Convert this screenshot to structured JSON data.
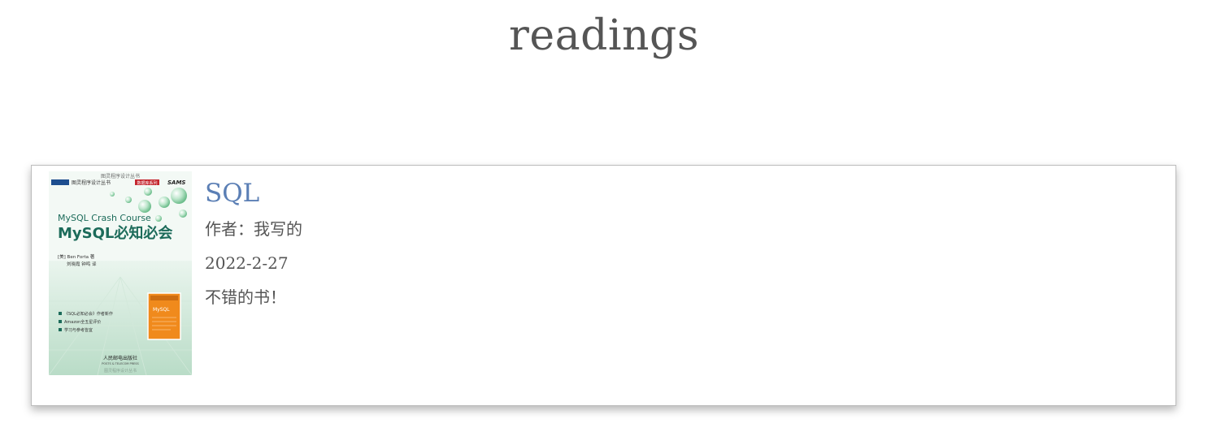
{
  "page": {
    "title": "readings"
  },
  "book": {
    "title": "SQL",
    "author_label": "作者：",
    "author": "我写的",
    "date": "2022-2-27",
    "review": "不错的书！",
    "cover": {
      "series_text": "图灵程序设计丛书",
      "series_badge": "数据库系列",
      "publisher_brand": "SAMS",
      "en_title": "MySQL Crash Course",
      "cn_title": "MySQL必知必会",
      "author_line": "[美] Ben Forta  著",
      "translator_line": "刘晓霞 钟鸣  译",
      "bullets": [
        "《SQL必知必会》作者新作",
        "Amazon全五星评价",
        "学习与参考皆宜"
      ],
      "inset_title": "MySQL",
      "publisher": "人民邮电出版社",
      "publisher_en": "POSTS & TELECOM PRESS",
      "colors": {
        "title_green": "#1c6b5a",
        "inset_orange": "#f08a1c",
        "badge_red": "#c4262e",
        "badge_blue": "#1d4e8f"
      }
    }
  }
}
